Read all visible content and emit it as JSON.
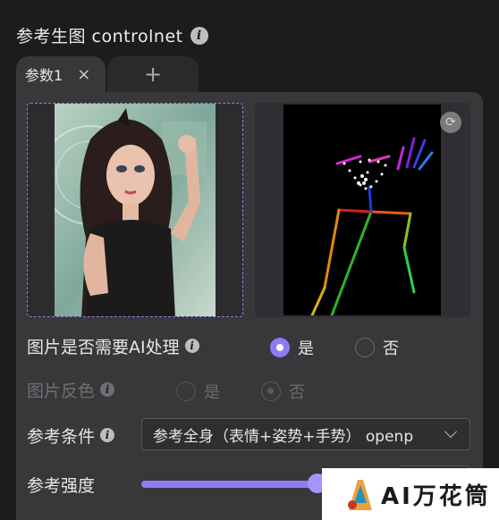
{
  "header": {
    "title": "参考生图 controlnet"
  },
  "tabs": [
    {
      "label": "参数1",
      "close": "×"
    },
    {
      "label": "+"
    }
  ],
  "options": {
    "ai_process": {
      "label": "图片是否需要AI处理",
      "yes": "是",
      "no": "否",
      "selected": "是"
    },
    "invert": {
      "label": "图片反色",
      "yes": "是",
      "no": "否",
      "selected": "否",
      "disabled": true
    },
    "condition": {
      "label": "参考条件",
      "value": "参考全身（表情+姿势+手势） openp"
    },
    "strength": {
      "label": "参考强度",
      "level": 0.9
    }
  },
  "watermark": {
    "text": "AI万花筒"
  },
  "colors": {
    "accent": "#8d7cf5",
    "panel": "#38383b",
    "background": "#1c1c1e"
  }
}
